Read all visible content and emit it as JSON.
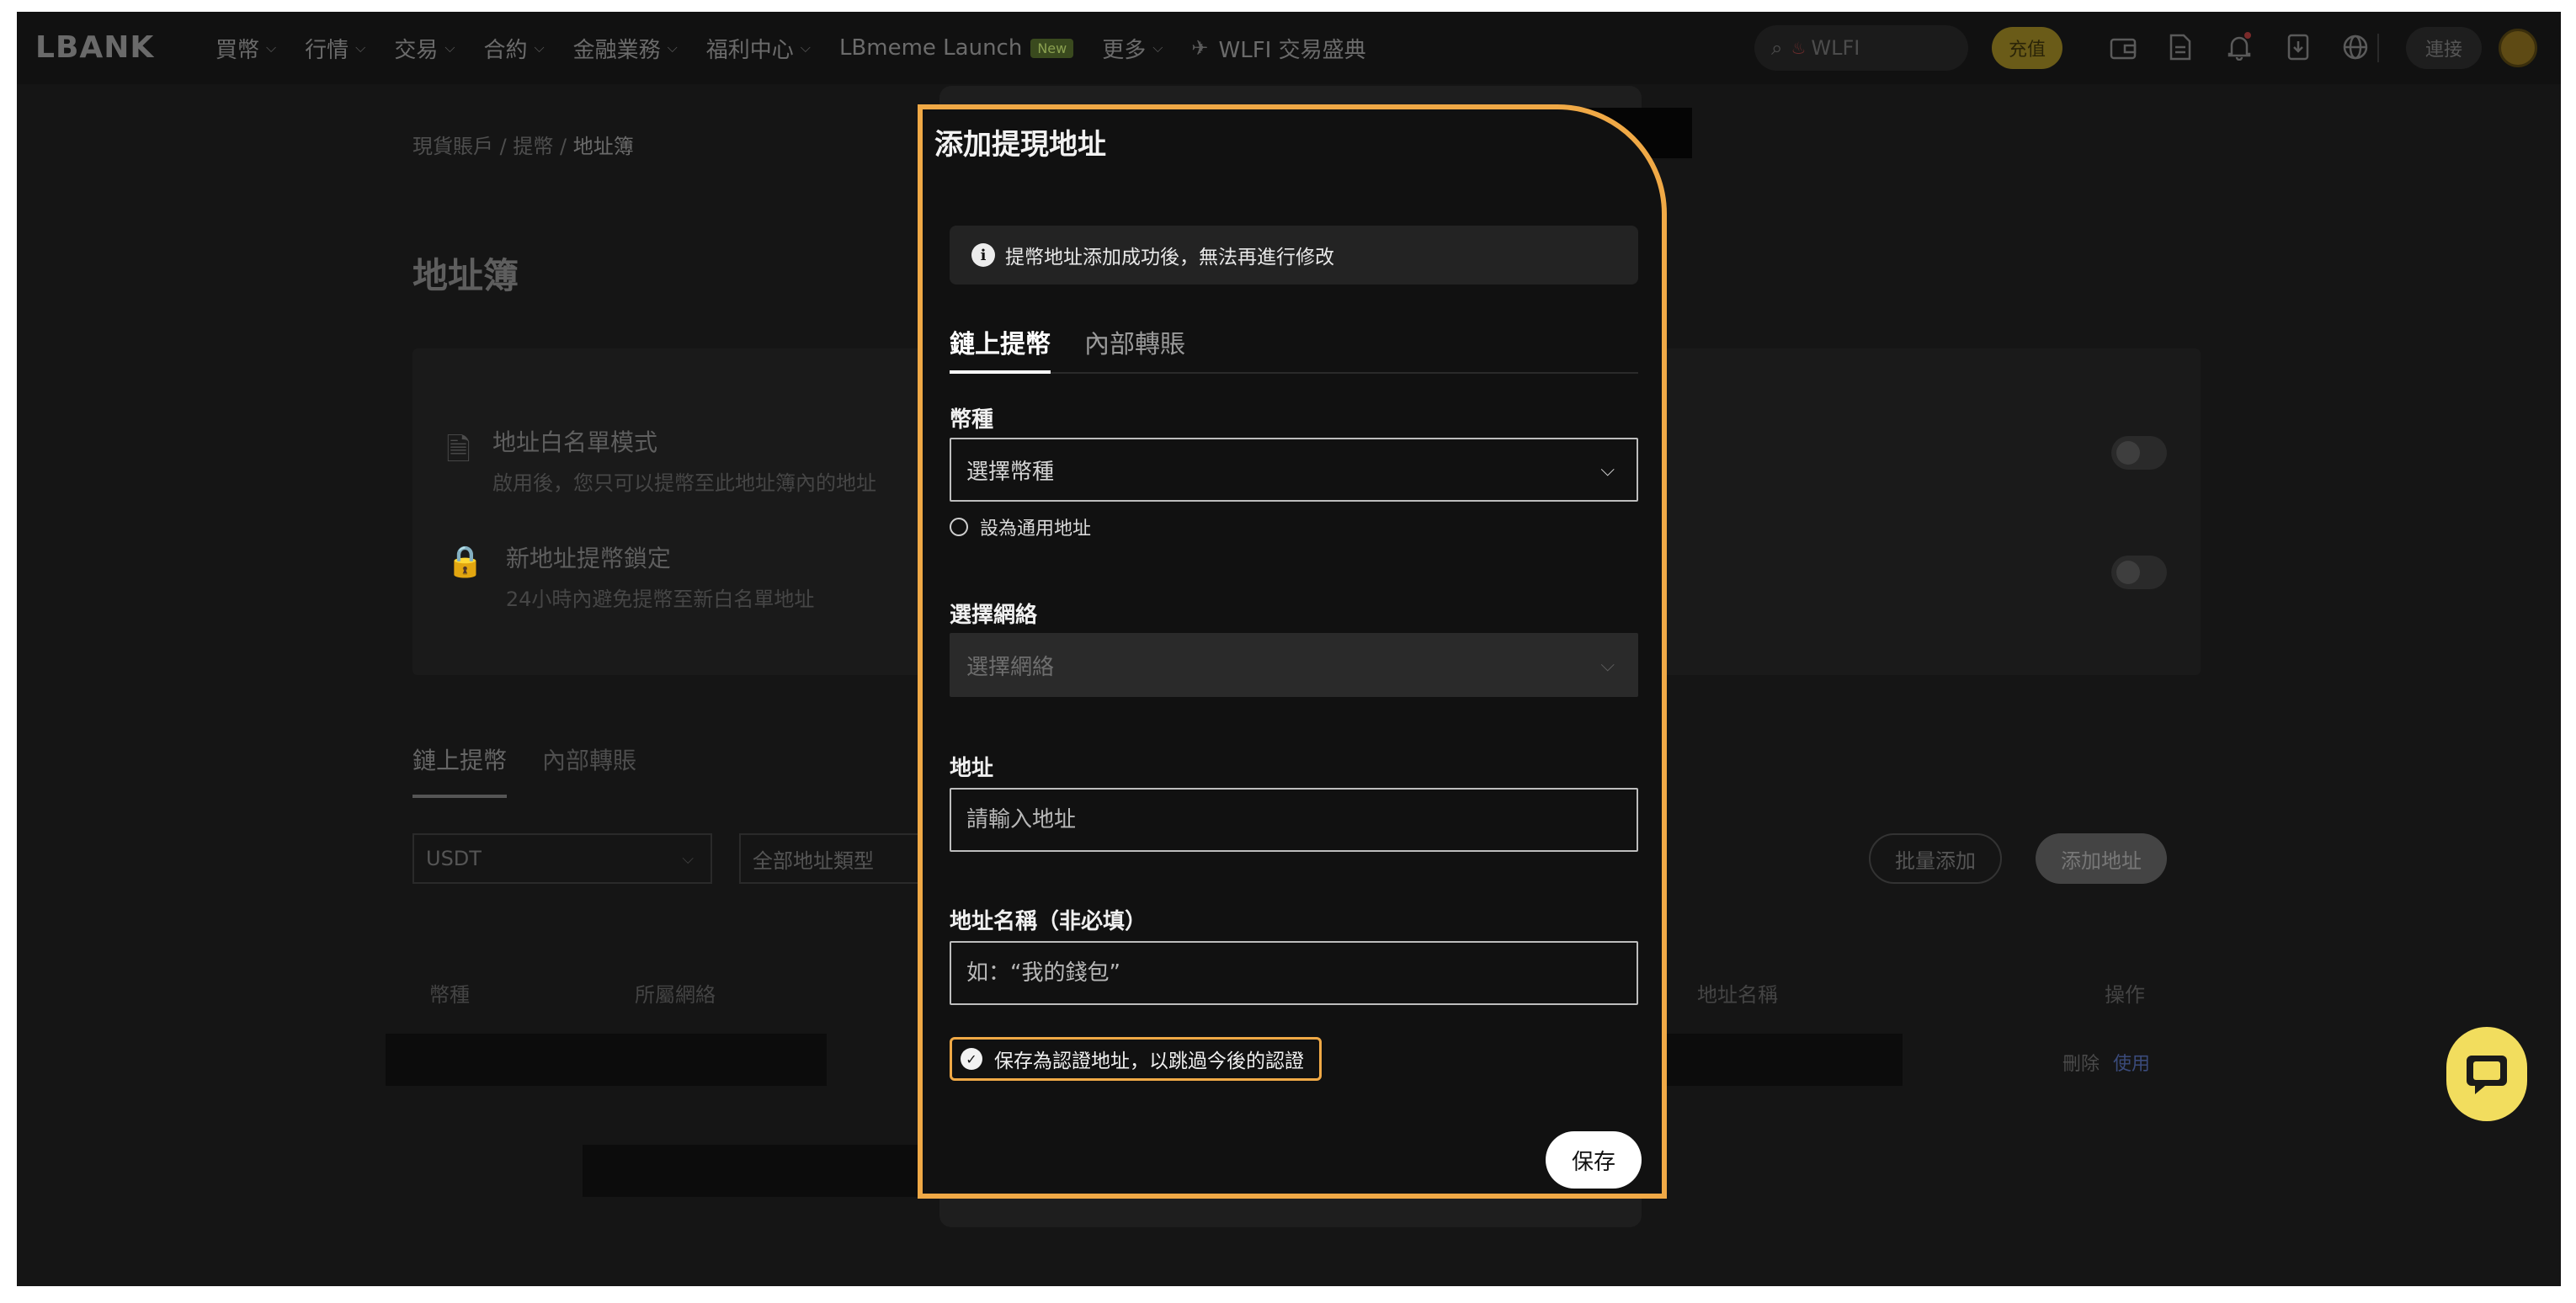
{
  "nav": {
    "logo": "LBANK",
    "menu": [
      {
        "label": "買幣",
        "chevron": true
      },
      {
        "label": "行情",
        "chevron": true
      },
      {
        "label": "交易",
        "chevron": true
      },
      {
        "label": "合約",
        "chevron": true
      },
      {
        "label": "金融業務",
        "chevron": true
      },
      {
        "label": "福利中心",
        "chevron": true
      },
      {
        "label": "LBmeme Launch",
        "badge": "New"
      },
      {
        "label": "更多",
        "chevron": true
      },
      {
        "label": "WLFI 交易盛典",
        "icon": "plane-icon"
      }
    ],
    "search_placeholder": "WLFI",
    "deposit_label": "充值",
    "connect_label": "連接",
    "icons": [
      "wallet-icon",
      "document-icon",
      "bell-icon",
      "download-icon",
      "globe-icon"
    ]
  },
  "page": {
    "breadcrumb": [
      "現貨賬戶",
      "提幣",
      "地址簿"
    ],
    "breadcrumb_sep": "/",
    "title": "地址簿",
    "whitelist": {
      "title": "地址白名單模式",
      "desc": "啟用後，您只可以提幣至此地址簿內的地址"
    },
    "lock": {
      "title": "新地址提幣鎖定",
      "desc": "24小時內避免提幣至新白名單地址"
    },
    "tabs": [
      "鏈上提幣",
      "內部轉賬"
    ],
    "coin_filter": "USDT",
    "type_filter": "全部地址類型",
    "batch_add": "批量添加",
    "add_address": "添加地址",
    "columns": [
      "幣種",
      "所屬網絡",
      "地址名稱",
      "操作"
    ],
    "row_actions": {
      "delete": "刪除",
      "use": "使用"
    }
  },
  "modal": {
    "title": "添加提現地址",
    "notice": "提幣地址添加成功後，無法再進行修改",
    "tabs": [
      {
        "label": "鏈上提幣",
        "active": true
      },
      {
        "label": "內部轉賬",
        "active": false
      }
    ],
    "coin_label": "幣種",
    "coin_placeholder": "選擇幣種",
    "universal_label": "設為通用地址",
    "network_label": "選擇網絡",
    "network_placeholder": "選擇網絡",
    "address_label": "地址",
    "address_placeholder": "請輸入地址",
    "name_label": "地址名稱（非必填）",
    "name_placeholder": "如：“我的錢包”",
    "cert_label": "保存為認證地址，以跳過今後的認證",
    "save_label": "保存"
  },
  "colors": {
    "accent": "#f0a946",
    "chat": "#f2dd5e",
    "use_link": "#3a4a7a"
  }
}
